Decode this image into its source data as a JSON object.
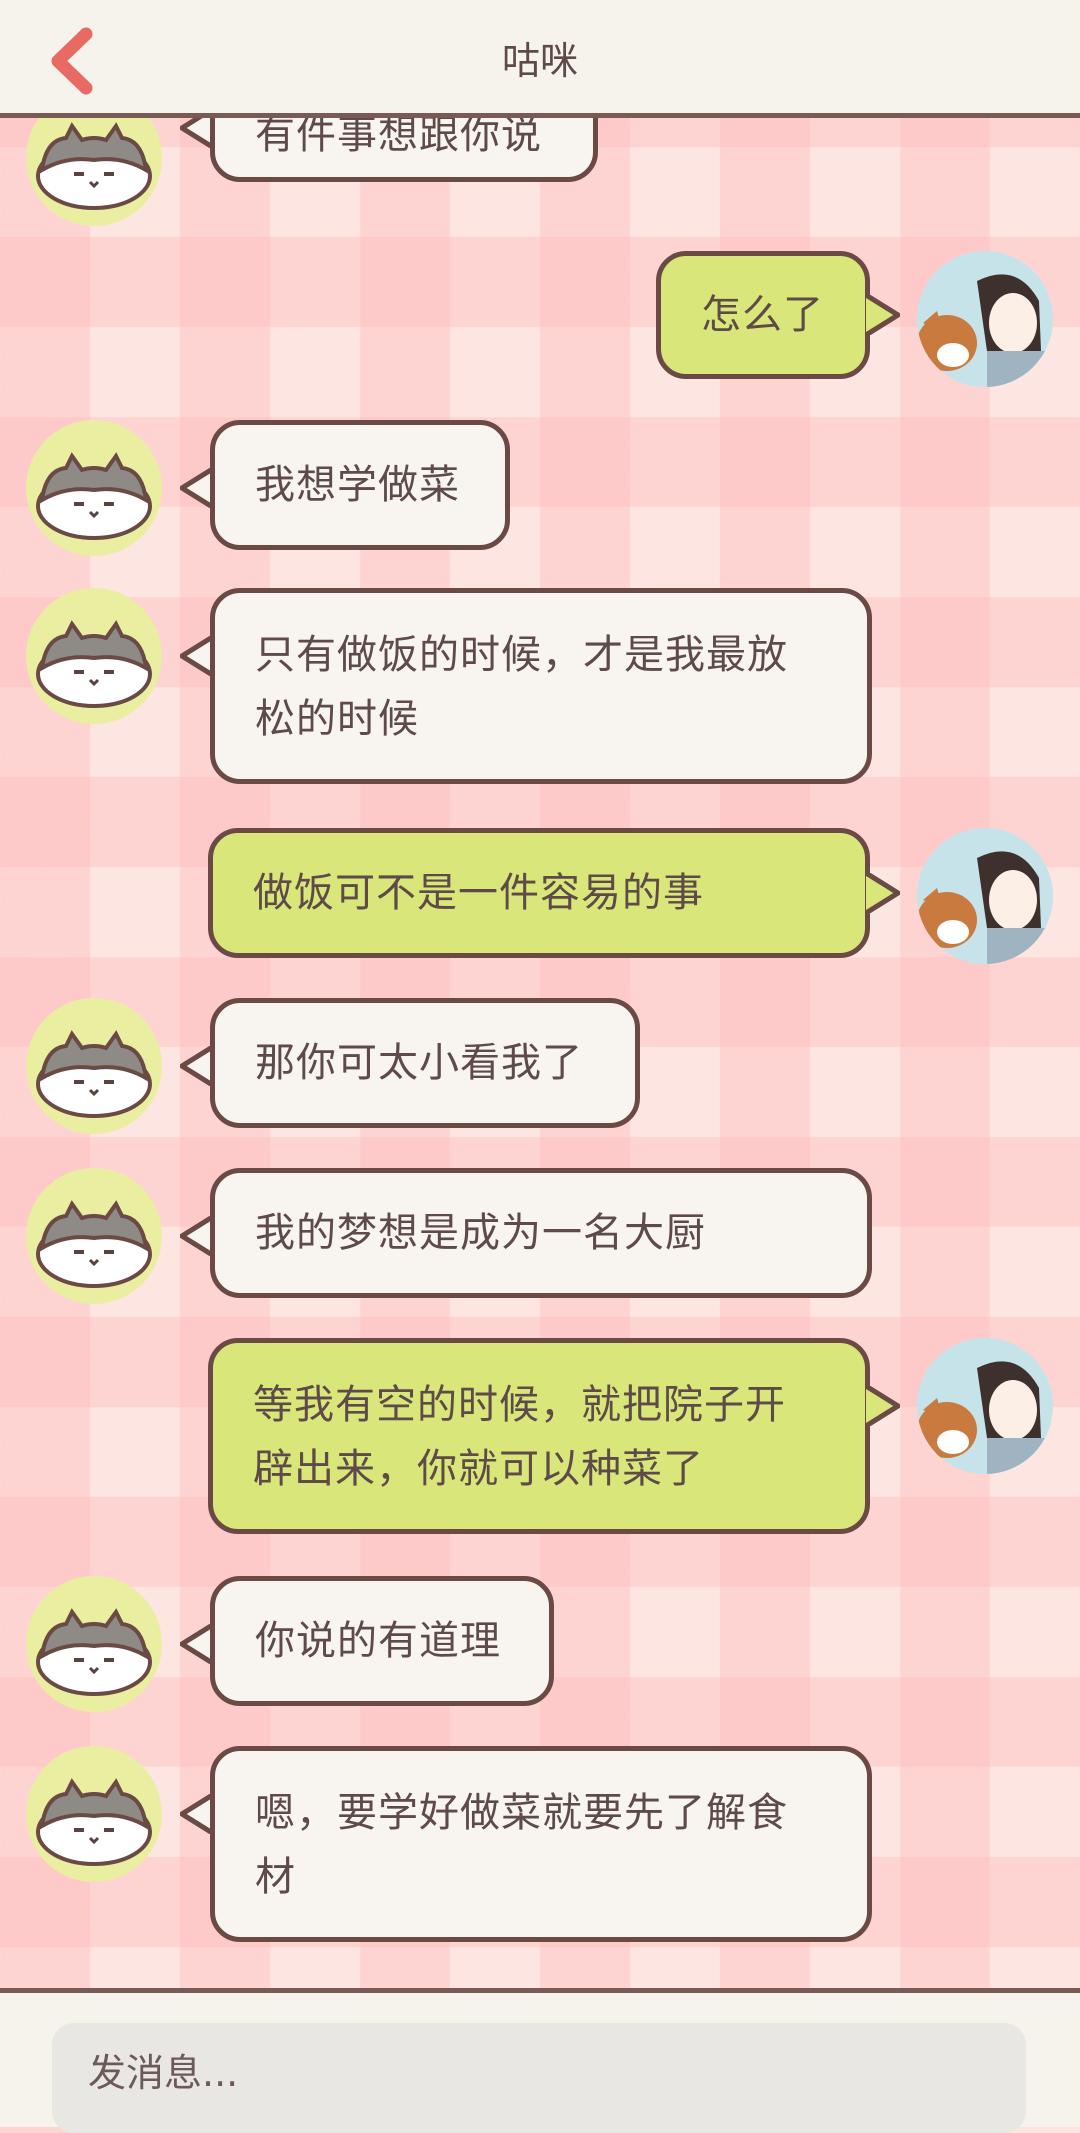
{
  "header": {
    "title": "咕咪"
  },
  "messages": [
    {
      "side": "left",
      "text": "有件事想跟你说"
    },
    {
      "side": "right",
      "text": "怎么了"
    },
    {
      "side": "left",
      "text": "我想学做菜"
    },
    {
      "side": "left",
      "text": "只有做饭的时候，才是我最放松的时候"
    },
    {
      "side": "right",
      "text": "做饭可不是一件容易的事"
    },
    {
      "side": "left",
      "text": "那你可太小看我了"
    },
    {
      "side": "left",
      "text": "我的梦想是成为一名大厨"
    },
    {
      "side": "right",
      "text": "等我有空的时候，就把院子开辟出来，你就可以种菜了"
    },
    {
      "side": "left",
      "text": "你说的有道理"
    },
    {
      "side": "left",
      "text": "嗯，要学好做菜就要先了解食材"
    }
  ],
  "composer": {
    "placeholder": "发消息..."
  },
  "icons": {
    "back": "chevron-left-icon",
    "cat_avatar": "cat-avatar",
    "user_avatar": "user-avatar"
  },
  "colors": {
    "accent_back": "#e86a63",
    "bubble_mine": "#d8e67a",
    "bubble_theirs": "#f8f4ef",
    "border": "#6b4a45"
  }
}
